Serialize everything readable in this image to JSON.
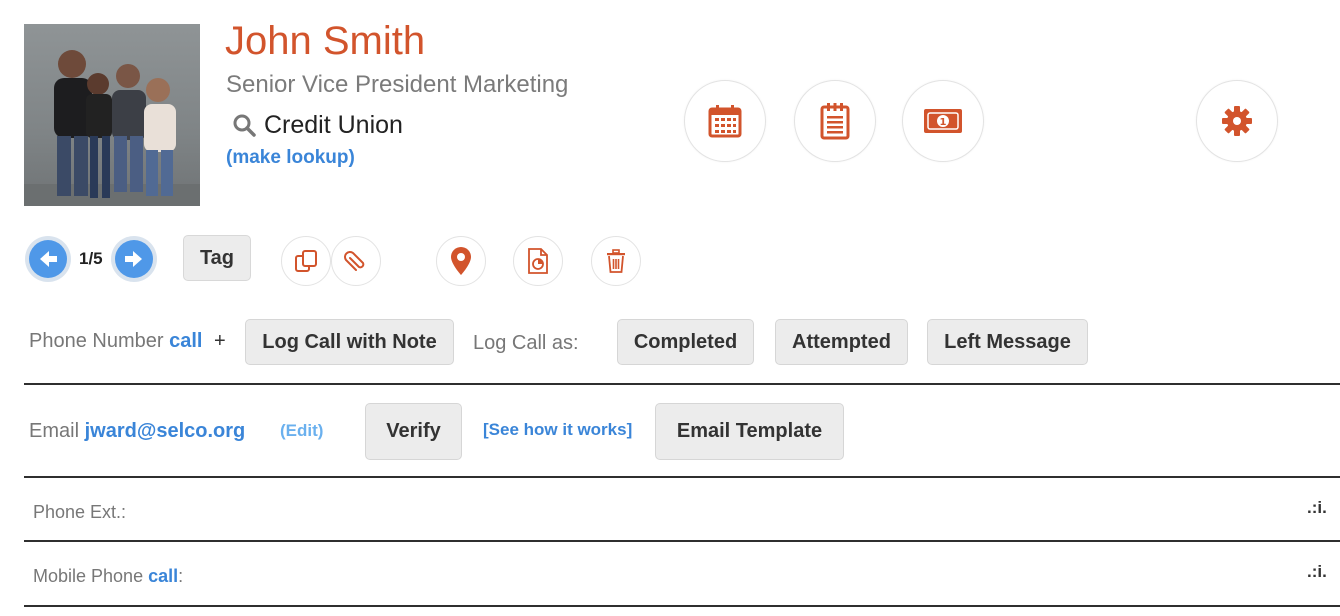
{
  "contact": {
    "name": "John Smith",
    "title": "Senior Vice President Marketing",
    "company": "Credit Union",
    "lookup_link": "(make lookup)"
  },
  "header_actions": {
    "icons": [
      "calendar-icon",
      "notepad-icon",
      "money-icon",
      "gear-icon"
    ]
  },
  "navigation": {
    "page_indicator": "1/5",
    "tag_label": "Tag",
    "tool_icons": [
      "copy-icon",
      "paperclip-icon",
      "map-pin-icon",
      "document-chart-icon",
      "trash-icon"
    ]
  },
  "phone_row": {
    "label": "Phone Number",
    "call_link": "call",
    "plus": "+",
    "log_call_button": "Log Call with Note",
    "log_as_label": "Log Call as:",
    "outcomes": [
      "Completed",
      "Attempted",
      "Left Message"
    ]
  },
  "email_row": {
    "label": "Email",
    "email": "jward@selco.org",
    "edit_link": "(Edit)",
    "verify_button": "Verify",
    "how_link": "[See how it works]",
    "template_button": "Email Template"
  },
  "fields": {
    "phone_ext_label": "Phone Ext.:",
    "mobile_label": "Mobile Phone",
    "mobile_call_link": "call",
    "mobile_colon": ":",
    "grip": ".:i."
  },
  "colors": {
    "accent": "#d2542c",
    "link": "#3a85d8",
    "nav_blue": "#4f98e8"
  }
}
